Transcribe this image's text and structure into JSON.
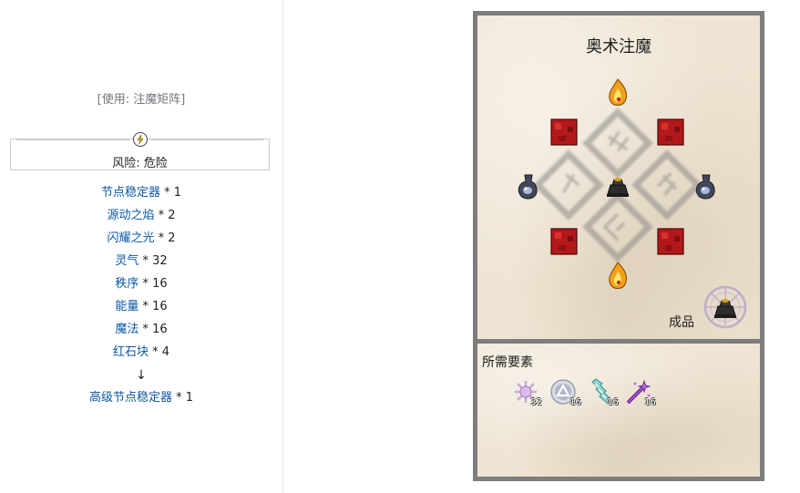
{
  "left": {
    "usage_text": "[使用: 注魔矩阵]",
    "risk_label": "风险: 危险",
    "ingredients": [
      {
        "name": "节点稳定器",
        "qty": "* 1"
      },
      {
        "name": "源动之焰",
        "qty": "* 2"
      },
      {
        "name": "闪耀之光",
        "qty": "* 2"
      },
      {
        "name": "灵气",
        "qty": "* 32"
      },
      {
        "name": "秩序",
        "qty": "* 16"
      },
      {
        "name": "能量",
        "qty": "* 16"
      },
      {
        "name": "魔法",
        "qty": "* 16"
      },
      {
        "name": "红石块",
        "qty": "* 4"
      }
    ],
    "arrow": "↓",
    "output": {
      "name": "高级节点稳定器",
      "qty": "* 1"
    }
  },
  "panel": {
    "title": "奥术注魔",
    "result_label": "成品",
    "needs_label": "所需要素",
    "aspects": [
      {
        "icon": "aura-aspect-icon",
        "count": "32"
      },
      {
        "icon": "order-aspect-icon",
        "count": "16"
      },
      {
        "icon": "energy-aspect-icon",
        "count": "16"
      },
      {
        "icon": "magic-aspect-icon",
        "count": "16"
      }
    ]
  },
  "colors": {
    "link": "#0b57a4",
    "frame": "#7d7d7d",
    "parchment": "#efe5d4",
    "redstone": "#b3191b"
  }
}
